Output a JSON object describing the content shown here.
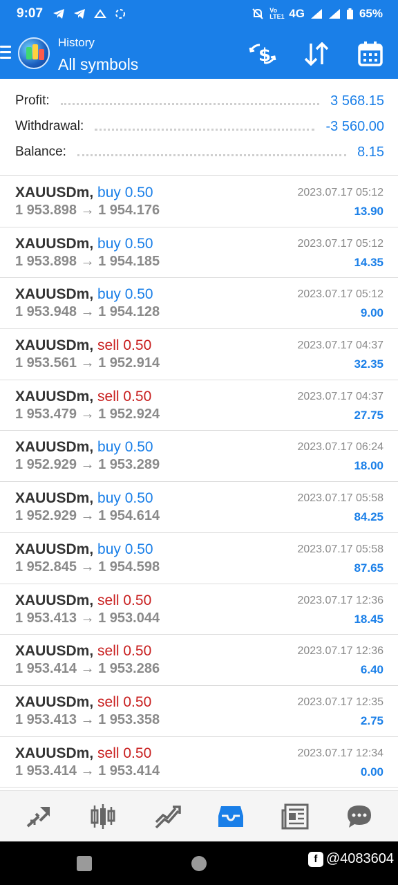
{
  "status_bar": {
    "time": "9:07",
    "network": "4G",
    "battery": "65%",
    "lte_label": "Vo LTE1"
  },
  "app_bar": {
    "subtitle": "History",
    "title": "All symbols",
    "icons": [
      "menu-icon",
      "app-logo",
      "currency-exchange-icon",
      "sort-icon",
      "calendar-icon"
    ]
  },
  "summary": {
    "profit_label": "Profit:",
    "profit_value": "3 568.15",
    "withdrawal_label": "Withdrawal:",
    "withdrawal_value": "-3 560.00",
    "balance_label": "Balance:",
    "balance_value": "8.15"
  },
  "deals": [
    {
      "symbol": "XAUUSDm,",
      "direction": "buy 0.50",
      "type": "buy",
      "prices": "1 953.898 → 1 954.176",
      "time": "2023.07.17 05:12",
      "profit": "13.90"
    },
    {
      "symbol": "XAUUSDm,",
      "direction": "buy 0.50",
      "type": "buy",
      "prices": "1 953.898 → 1 954.185",
      "time": "2023.07.17 05:12",
      "profit": "14.35"
    },
    {
      "symbol": "XAUUSDm,",
      "direction": "buy 0.50",
      "type": "buy",
      "prices": "1 953.948 → 1 954.128",
      "time": "2023.07.17 05:12",
      "profit": "9.00"
    },
    {
      "symbol": "XAUUSDm,",
      "direction": "sell 0.50",
      "type": "sell",
      "prices": "1 953.561 → 1 952.914",
      "time": "2023.07.17 04:37",
      "profit": "32.35"
    },
    {
      "symbol": "XAUUSDm,",
      "direction": "sell 0.50",
      "type": "sell",
      "prices": "1 953.479 → 1 952.924",
      "time": "2023.07.17 04:37",
      "profit": "27.75"
    },
    {
      "symbol": "XAUUSDm,",
      "direction": "buy 0.50",
      "type": "buy",
      "prices": "1 952.929 → 1 953.289",
      "time": "2023.07.17 06:24",
      "profit": "18.00"
    },
    {
      "symbol": "XAUUSDm,",
      "direction": "buy 0.50",
      "type": "buy",
      "prices": "1 952.929 → 1 954.614",
      "time": "2023.07.17 05:58",
      "profit": "84.25"
    },
    {
      "symbol": "XAUUSDm,",
      "direction": "buy 0.50",
      "type": "buy",
      "prices": "1 952.845 → 1 954.598",
      "time": "2023.07.17 05:58",
      "profit": "87.65"
    },
    {
      "symbol": "XAUUSDm,",
      "direction": "sell 0.50",
      "type": "sell",
      "prices": "1 953.413 → 1 953.044",
      "time": "2023.07.17 12:36",
      "profit": "18.45"
    },
    {
      "symbol": "XAUUSDm,",
      "direction": "sell 0.50",
      "type": "sell",
      "prices": "1 953.414 → 1 953.286",
      "time": "2023.07.17 12:36",
      "profit": "6.40"
    },
    {
      "symbol": "XAUUSDm,",
      "direction": "sell 0.50",
      "type": "sell",
      "prices": "1 953.413 → 1 953.358",
      "time": "2023.07.17 12:35",
      "profit": "2.75"
    },
    {
      "symbol": "XAUUSDm,",
      "direction": "sell 0.50",
      "type": "sell",
      "prices": "1 953.414 → 1 953.414",
      "time": "2023.07.17 12:34",
      "profit": "0.00"
    }
  ],
  "bottom_nav": [
    "quotes-icon",
    "chart-icon",
    "trade-icon",
    "history-icon",
    "news-icon",
    "messages-icon"
  ],
  "watermark": {
    "logo": "f",
    "text": "@4083604"
  },
  "colors": {
    "accent": "#1a7fe8",
    "sell": "#c81e1e",
    "muted": "#8a8a8a"
  }
}
